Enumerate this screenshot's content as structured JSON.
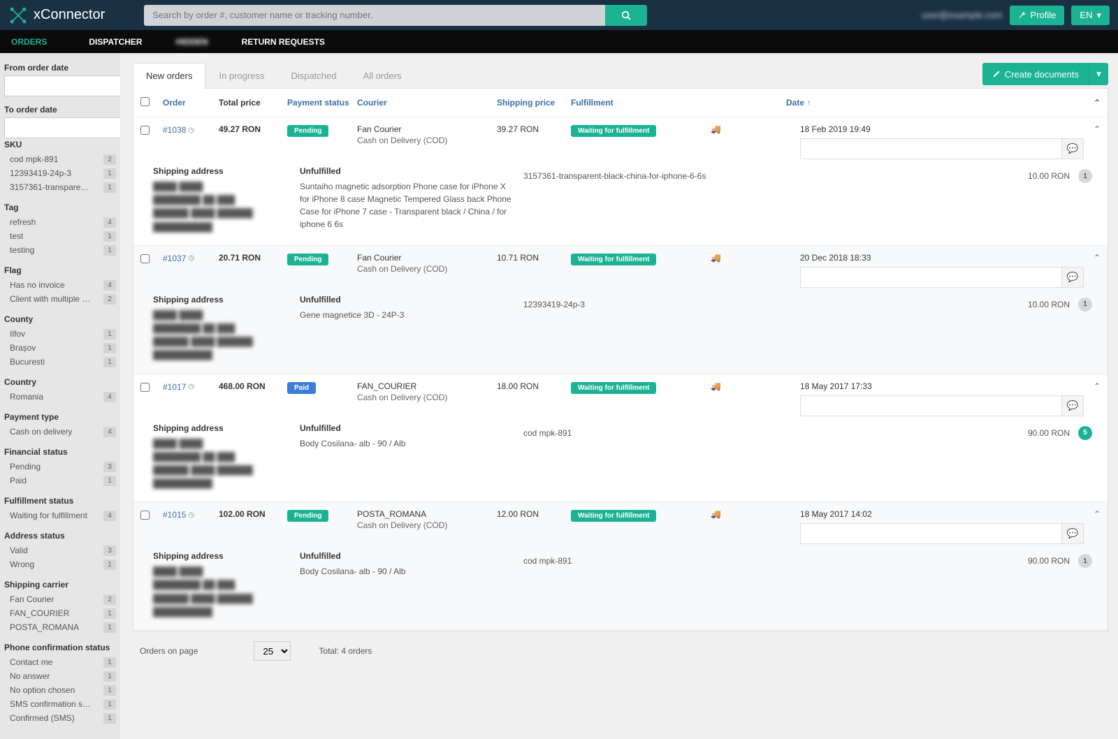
{
  "brand": "xConnector",
  "search": {
    "placeholder": "Search by order #, customer name or tracking number."
  },
  "header": {
    "user": "user@example.com",
    "profile_btn": "Profile",
    "lang_btn": "EN"
  },
  "nav": {
    "orders": "ORDERS",
    "dispatcher": "DISPATCHER",
    "hidden": "HIDDEN",
    "returns": "RETURN REQUESTS"
  },
  "tabs": {
    "new": "New orders",
    "in_progress": "In progress",
    "dispatched": "Dispatched",
    "all": "All orders"
  },
  "create_btn": "Create documents",
  "filters": {
    "from_date": "From order date",
    "to_date": "To order date",
    "sku": {
      "label": "SKU",
      "items": [
        {
          "label": "cod mpk-891",
          "count": "2"
        },
        {
          "label": "12393419-24p-3",
          "count": "1"
        },
        {
          "label": "3157361-transparent-bla...",
          "count": "1"
        }
      ]
    },
    "tag": {
      "label": "Tag",
      "items": [
        {
          "label": "refresh",
          "count": "4"
        },
        {
          "label": "test",
          "count": "1"
        },
        {
          "label": "testing",
          "count": "1"
        }
      ]
    },
    "flag": {
      "label": "Flag",
      "items": [
        {
          "label": "Has no invoice",
          "count": "4"
        },
        {
          "label": "Client with multiple orders",
          "count": "2"
        }
      ]
    },
    "county": {
      "label": "County",
      "items": [
        {
          "label": "Ilfov",
          "count": "1"
        },
        {
          "label": "Brașov",
          "count": "1"
        },
        {
          "label": "Bucuresti",
          "count": "1"
        }
      ]
    },
    "country": {
      "label": "Country",
      "items": [
        {
          "label": "Romania",
          "count": "4"
        }
      ]
    },
    "payment_type": {
      "label": "Payment type",
      "items": [
        {
          "label": "Cash on delivery",
          "count": "4"
        }
      ]
    },
    "financial_status": {
      "label": "Financial status",
      "items": [
        {
          "label": "Pending",
          "count": "3"
        },
        {
          "label": "Paid",
          "count": "1"
        }
      ]
    },
    "fulfillment_status": {
      "label": "Fulfillment status",
      "items": [
        {
          "label": "Waiting for fulfillment",
          "count": "4"
        }
      ]
    },
    "address_status": {
      "label": "Address status",
      "items": [
        {
          "label": "Valid",
          "count": "3"
        },
        {
          "label": "Wrong",
          "count": "1"
        }
      ]
    },
    "shipping_carrier": {
      "label": "Shipping carrier",
      "items": [
        {
          "label": "Fan Courier",
          "count": "2"
        },
        {
          "label": "FAN_COURIER",
          "count": "1"
        },
        {
          "label": "POSTA_ROMANA",
          "count": "1"
        }
      ]
    },
    "phone_confirmation": {
      "label": "Phone confirmation status",
      "items": [
        {
          "label": "Contact me",
          "count": "1"
        },
        {
          "label": "No answer",
          "count": "1"
        },
        {
          "label": "No option chosen",
          "count": "1"
        },
        {
          "label": "SMS confirmation sent",
          "count": "1"
        },
        {
          "label": "Confirmed (SMS)",
          "count": "1"
        }
      ]
    }
  },
  "columns": {
    "order": "Order",
    "total_price": "Total price",
    "payment_status": "Payment status",
    "courier": "Courier",
    "shipping_price": "Shipping price",
    "fulfillment": "Fulfillment",
    "date": "Date"
  },
  "labels": {
    "shipping_address": "Shipping address",
    "unfulfilled": "Unfulfilled",
    "orders_on_page": "Orders on page",
    "per_page": "25",
    "total": "Total: 4 orders"
  },
  "orders": [
    {
      "id": "#1038",
      "total": "49.27 RON",
      "payment": "Pending",
      "payment_class": "pending",
      "courier": "Fan Courier",
      "method": "Cash on Delivery (COD)",
      "shipping": "39.27 RON",
      "fulfillment": "Waiting for fulfillment",
      "date": "18 Feb 2019 19:49",
      "product": "Suntaiho magnetic adsorption Phone case for iPhone X for iPhone 8 case Magnetic Tempered Glass back Phone Case for iPhone 7 case - Transparent black / China / for iphone 6 6s",
      "line_sku": "3157361-transparent-black-china-for-iphone-6-6s",
      "line_price": "10.00 RON",
      "qty": "1",
      "qty_teal": false
    },
    {
      "id": "#1037",
      "total": "20.71 RON",
      "payment": "Pending",
      "payment_class": "pending",
      "courier": "Fan Courier",
      "method": "Cash on Delivery (COD)",
      "shipping": "10.71 RON",
      "fulfillment": "Waiting for fulfillment",
      "date": "20 Dec 2018 18:33",
      "product": "Gene magnetice 3D - 24P-3",
      "line_sku": "12393419-24p-3",
      "line_price": "10.00 RON",
      "qty": "1",
      "qty_teal": false
    },
    {
      "id": "#1017",
      "total": "468.00 RON",
      "payment": "Paid",
      "payment_class": "paid",
      "courier": "FAN_COURIER",
      "method": "Cash on Delivery (COD)",
      "shipping": "18.00 RON",
      "fulfillment": "Waiting for fulfillment",
      "date": "18 May 2017 17:33",
      "product": "Body Cosilana- alb - 90 / Alb",
      "line_sku": "cod mpk-891",
      "line_price": "90.00 RON",
      "qty": "5",
      "qty_teal": true
    },
    {
      "id": "#1015",
      "total": "102.00 RON",
      "payment": "Pending",
      "payment_class": "pending",
      "courier": "POSTA_ROMANA",
      "method": "Cash on Delivery (COD)",
      "shipping": "12.00 RON",
      "fulfillment": "Waiting for fulfillment",
      "date": "18 May 2017 14:02",
      "product": "Body Cosilana- alb - 90 / Alb",
      "line_sku": "cod mpk-891",
      "line_price": "90.00 RON",
      "qty": "1",
      "qty_teal": false
    }
  ]
}
